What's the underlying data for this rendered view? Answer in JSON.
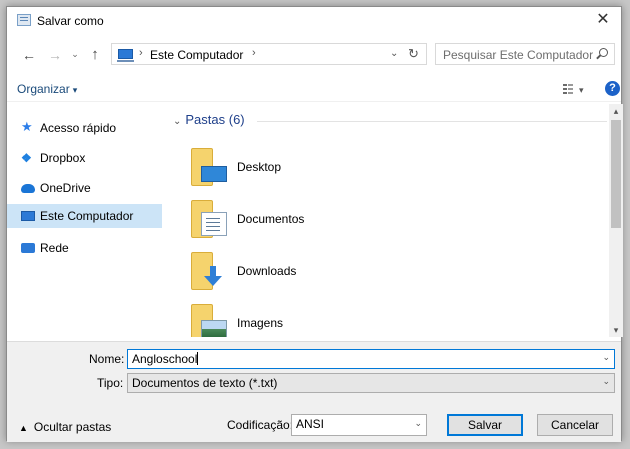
{
  "window": {
    "title": "Salvar como",
    "close_glyph": "✕"
  },
  "nav_buttons": {
    "back": "←",
    "forward": "→",
    "recent": "⌄",
    "up": "↑"
  },
  "address": {
    "separator": "›",
    "location": "Este Computador",
    "dropdown_glyph": "⌄",
    "refresh_glyph": "↻"
  },
  "search": {
    "placeholder": "Pesquisar Este Computador"
  },
  "toolbar": {
    "organize_label": "Organizar",
    "caret": "▾",
    "help_label": "?"
  },
  "nav_pane": {
    "items": [
      {
        "label": "Acesso rápido",
        "icon": "star-icon"
      },
      {
        "label": "Dropbox",
        "icon": "dropbox-icon"
      },
      {
        "label": "OneDrive",
        "icon": "onedrive-icon"
      },
      {
        "label": "Este Computador",
        "icon": "computer-icon",
        "selected": true
      },
      {
        "label": "Rede",
        "icon": "network-icon"
      }
    ]
  },
  "content": {
    "group_header": "Pastas (6)",
    "folders": [
      {
        "label": "Desktop"
      },
      {
        "label": "Documentos"
      },
      {
        "label": "Downloads"
      },
      {
        "label": "Imagens"
      }
    ]
  },
  "form": {
    "name_label": "Nome:",
    "name_value": "Angloschool",
    "type_label": "Tipo:",
    "type_value": "Documentos de texto (*.txt)",
    "encoding_label": "Codificação:",
    "encoding_value": "ANSI"
  },
  "footer": {
    "hide_folders_label": "Ocultar pastas",
    "save_label": "Salvar",
    "cancel_label": "Cancelar"
  }
}
